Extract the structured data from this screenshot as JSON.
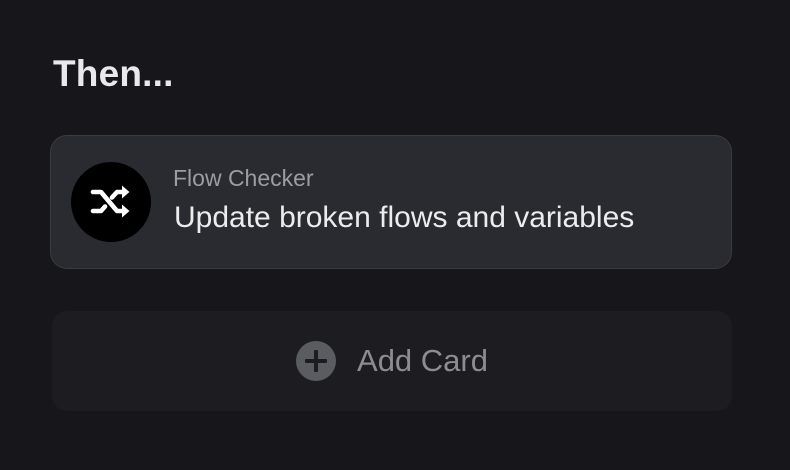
{
  "section": {
    "title": "Then..."
  },
  "action_card": {
    "app_name": "Flow Checker",
    "action_label": "Update broken flows and variables",
    "icon": "shuffle-icon"
  },
  "add_card": {
    "label": "Add Card",
    "icon": "plus-circle-icon"
  },
  "colors": {
    "background": "#16161b",
    "card_background": "#2a2a31",
    "add_card_background": "#1c1c21",
    "avatar_background": "#000000"
  }
}
